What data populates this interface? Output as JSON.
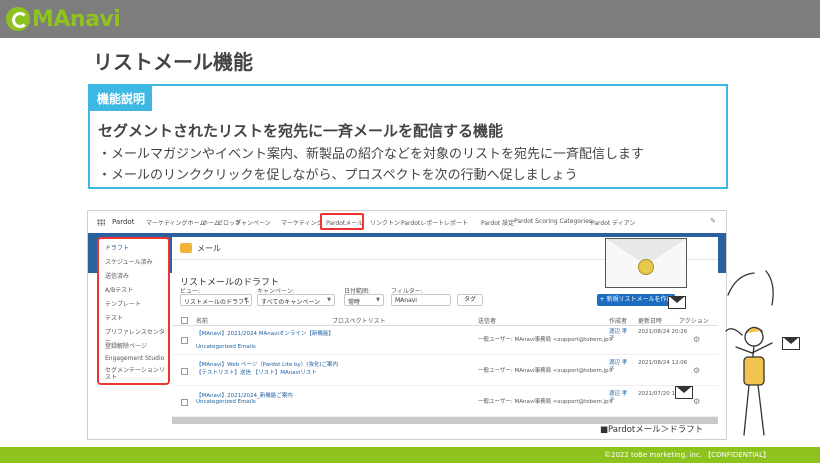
{
  "header": {
    "logo_text": "MAnavi",
    "brand_color": "#8dc21f",
    "bar_color": "#7d7d7d"
  },
  "page_title": "リストメール機能",
  "feature": {
    "label": "機能説明",
    "heading": "セグメントされたリストを宛先に一斉メールを配信する機能",
    "lines": [
      "・メールマガジンやイベント案内、新製品の紹介などを対象のリストを宛先に一斉配信します",
      "・メールのリンククリックを促しながら、プロスペクトを次の行動へ促しましょう"
    ],
    "accent_color": "#3fb7e3"
  },
  "screenshot": {
    "app_name": "Pardot",
    "nav_items": [
      "マーケティングホーム",
      "ホーム",
      "ゼロップ",
      "キャンペーン",
      "マーケティング",
      "Pardotメール",
      "リンクトン",
      "Pardotレポート",
      "レポート",
      "Pardot 設定",
      "Pardot Scoring Categories",
      "Pardot ディアン"
    ],
    "highlighted_nav": "Pardotメール",
    "sidebar_items": [
      "ドラフト",
      "スケジュール済み",
      "送信済み",
      "A/Bテスト",
      "テンプレート",
      "テスト",
      "プリファレンスセンター",
      "登録解除ページ",
      "Engagement Studio",
      "セグメンテーションリスト"
    ],
    "mail_header": "メール",
    "list_title": "リストメールのドラフト",
    "filters": {
      "view_label": "ビュー:",
      "view_value": "リストメールのドラフト",
      "campaign_label": "キャンペーン:",
      "campaign_value": "すべてのキャンペーン",
      "date_label": "日付範囲:",
      "date_value": "常時",
      "filter_label": "フィルター:",
      "filter_value": "MAnavi",
      "tag_button": "タグ",
      "new_button": "+ 新規リストメールを作成"
    },
    "columns": [
      "名前",
      "プロスペクトリスト",
      "送信者",
      "作成者",
      "更新日時",
      "アクション"
    ],
    "rows": [
      {
        "name": "【MAnavi】2021/2024 MAnaviオンライン【新機能】",
        "sub": "",
        "folder": "Uncategorized Emails",
        "sender": "一般ユーザー: MAnavi事務局 <support@tobem.jp>",
        "author": "渡辺 孝子",
        "date": "2021/08/24 20:26"
      },
      {
        "name": "【MAnavi】Web ページ（Pardot Lite by）(強化)ご案内",
        "sub": "【テストリスト】送信 【リスト】MAnaviリスト",
        "folder": "Uncategorized Emails",
        "sender": "一般ユーザー: MAnavi事務局 <support@tobem.jp>",
        "author": "渡辺 孝子",
        "date": "2021/08/24 12:06"
      },
      {
        "name": "【MAnavi】2021/2024_新機能ご案内",
        "sub": "",
        "folder": "Uncategorized Emails",
        "sender": "一般ユーザー: MAnavi事務局 <support@tobem.jp>",
        "author": "渡辺 孝子",
        "date": "2021/07/20 10:48"
      }
    ]
  },
  "caption": "■Pardotメール＞ドラフト",
  "footer": {
    "copyright": "©2022 toBe marketing, inc.  【CONFIDENTIAL】"
  }
}
